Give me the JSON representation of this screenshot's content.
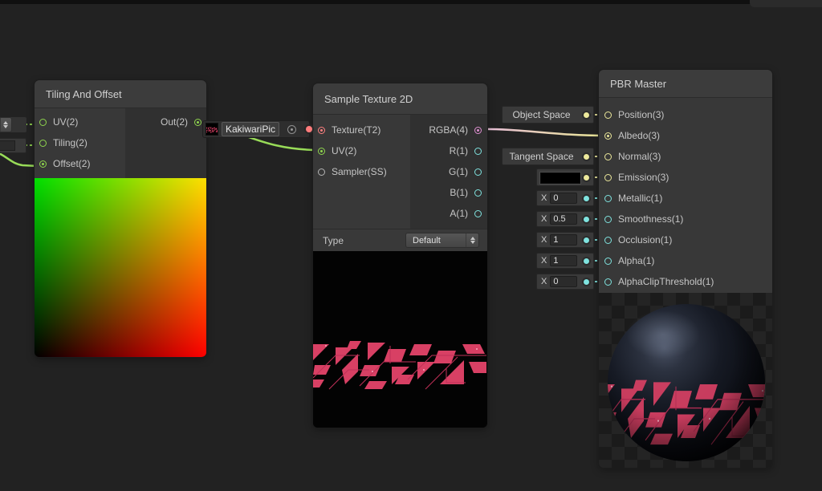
{
  "graph": {
    "nodes": {
      "tiling": {
        "title": "Tiling And Offset",
        "inputs": [
          {
            "label": "UV(2)"
          },
          {
            "label": "Tiling(2)"
          },
          {
            "label": "Offset(2)"
          }
        ],
        "output": {
          "label": "Out(2)"
        }
      },
      "sample": {
        "title": "Sample Texture 2D",
        "inputs": [
          {
            "label": "Texture(T2)"
          },
          {
            "label": "UV(2)"
          },
          {
            "label": "Sampler(SS)"
          }
        ],
        "outputs": [
          {
            "label": "RGBA(4)"
          },
          {
            "label": "R(1)"
          },
          {
            "label": "G(1)"
          },
          {
            "label": "B(1)"
          },
          {
            "label": "A(1)"
          }
        ],
        "type_label": "Type",
        "type_value": "Default"
      },
      "pbr": {
        "title": "PBR Master",
        "inputs": [
          {
            "label": "Position(3)"
          },
          {
            "label": "Albedo(3)"
          },
          {
            "label": "Normal(3)"
          },
          {
            "label": "Emission(3)"
          },
          {
            "label": "Metallic(1)"
          },
          {
            "label": "Smoothness(1)"
          },
          {
            "label": "Occlusion(1)"
          },
          {
            "label": "Alpha(1)"
          },
          {
            "label": "AlphaClipThreshold(1)"
          }
        ]
      }
    },
    "property_node": {
      "label": "KakiwariPic"
    },
    "widgets": {
      "position_space": "Object Space",
      "normal_space": "Tangent Space",
      "x_prefix": "X",
      "scalars": [
        {
          "name": "metallic",
          "value": "0"
        },
        {
          "name": "smoothness",
          "value": "0.5"
        },
        {
          "name": "occlusion",
          "value": "1"
        },
        {
          "name": "alpha",
          "value": "1"
        },
        {
          "name": "alphaclipthreshold",
          "value": "0"
        }
      ],
      "emission_color": "#000000"
    },
    "colors": {
      "vector1": "#7fe3df",
      "vector2": "#8fd54e",
      "vector3": "#ece89b",
      "vector4": "#de8fd0",
      "texture": "#ff8080",
      "wire_green": "#98db58",
      "wire_pink": "#e7bbdc",
      "wire_yellow": "#e9e694",
      "canvas_bg": "#222222",
      "node_bg": "#383838",
      "pattern_pink": "#d84064"
    }
  }
}
